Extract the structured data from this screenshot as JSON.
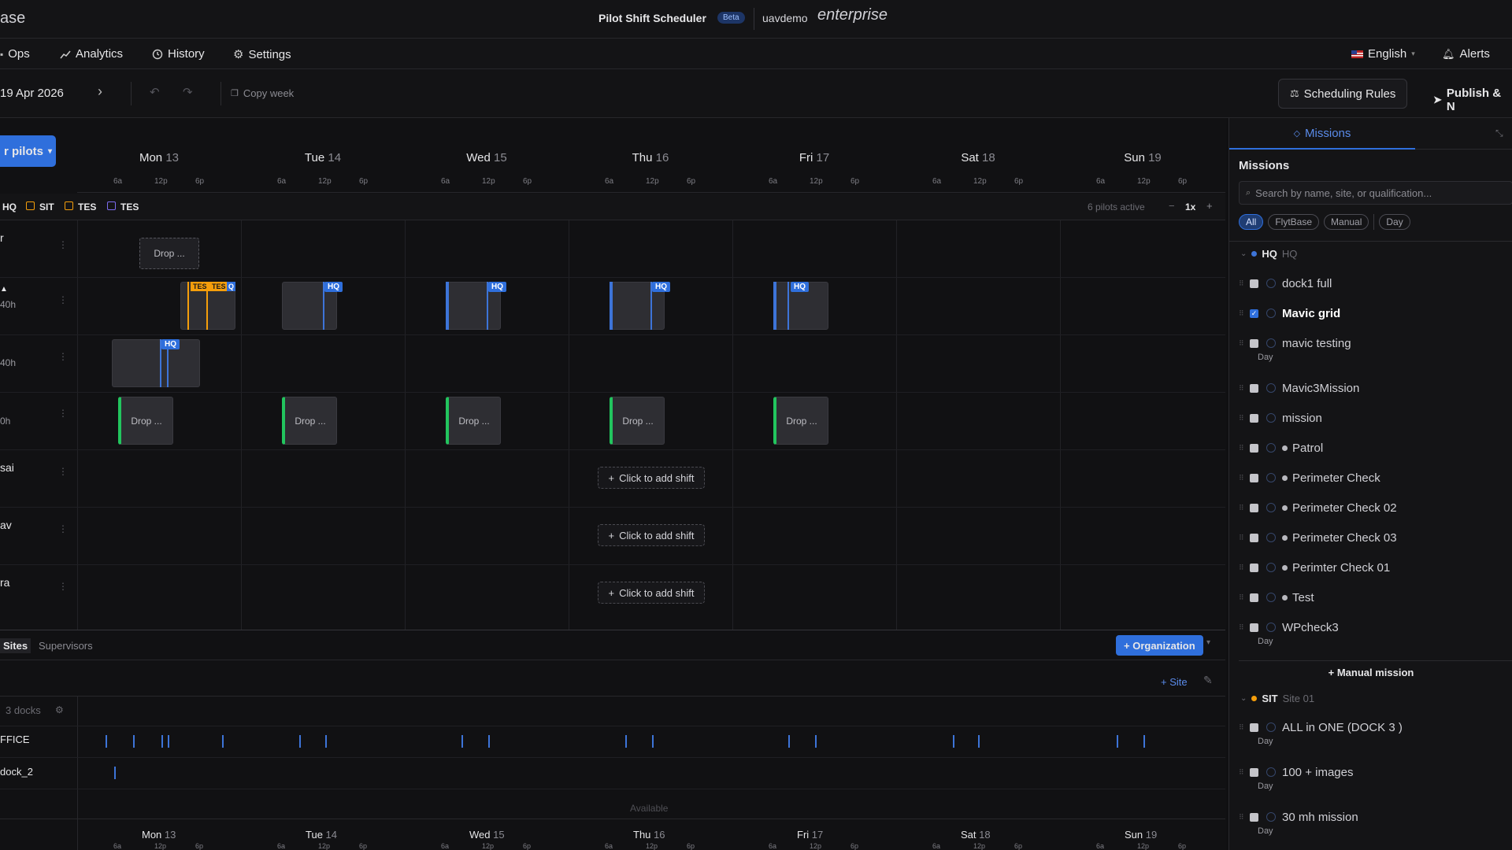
{
  "topbar": {
    "brand_fragment": "ase",
    "app_title": "Pilot Shift Scheduler",
    "beta_badge": "Beta",
    "org": "uavdemo",
    "logo_text": "enterprise"
  },
  "nav": {
    "tabs": [
      {
        "label": "Ops",
        "icon": "ops-icon"
      },
      {
        "label": "Analytics",
        "icon": "analytics-icon"
      },
      {
        "label": "History",
        "icon": "history-icon"
      },
      {
        "label": "Settings",
        "icon": "gear-icon"
      }
    ],
    "language": "English",
    "alerts": "Alerts"
  },
  "toolbar": {
    "date_range": "19 Apr 2026",
    "copy_week": "Copy week",
    "scheduling_rules": "Scheduling Rules",
    "publish": "Publish & N"
  },
  "schedule": {
    "filter_button": "r pilots",
    "days": [
      {
        "name": "Mon",
        "num": "13"
      },
      {
        "name": "Tue",
        "num": "14"
      },
      {
        "name": "Wed",
        "num": "15"
      },
      {
        "name": "Thu",
        "num": "16"
      },
      {
        "name": "Fri",
        "num": "17"
      },
      {
        "name": "Sat",
        "num": "18"
      },
      {
        "name": "Sun",
        "num": "19"
      }
    ],
    "ticks": [
      "6a",
      "12p",
      "6p"
    ],
    "site_filters": [
      "HQ",
      "SIT",
      "TES",
      "TES"
    ],
    "pilots_active": "6 pilots active",
    "zoom": "1x",
    "zoom_minus": "−",
    "zoom_plus": "+",
    "rows": [
      {
        "name": "r",
        "hours": ""
      },
      {
        "name": "",
        "hours": "40h"
      },
      {
        "name": "",
        "hours": "40h"
      },
      {
        "name": "",
        "hours": "0h"
      },
      {
        "name": "sai",
        "hours": ""
      },
      {
        "name": "av",
        "hours": ""
      },
      {
        "name": "ra",
        "hours": ""
      }
    ],
    "drop_label": "Drop ...",
    "hq_label": "HQ",
    "tes_label": "TES",
    "tes_label_2": "TES",
    "add_shift_label": "Click to add shift"
  },
  "bottom": {
    "tabs": [
      "Sites",
      "Supervisors"
    ],
    "organization_button": "+ Organization",
    "site_button": "+ Site",
    "docks_count": "3 docks",
    "dock_rows": [
      "FFICE",
      "dock_2"
    ],
    "available": "Available"
  },
  "right_panel": {
    "tab": "Missions",
    "heading": "Missions",
    "search_placeholder": "Search by name, site, or qualification...",
    "filters": [
      "All",
      "FlytBase",
      "Manual",
      "Day"
    ],
    "groups": [
      {
        "code": "HQ",
        "name": "HQ",
        "items": [
          {
            "label": "dock1 full",
            "checked": false,
            "tag": ""
          },
          {
            "label": "Mavic grid",
            "checked": true,
            "tag": ""
          },
          {
            "label": "mavic testing",
            "checked": false,
            "tag": "Day"
          },
          {
            "label": "Mavic3Mission",
            "checked": false,
            "tag": ""
          },
          {
            "label": "mission",
            "checked": false,
            "tag": ""
          },
          {
            "label": "Patrol",
            "checked": false,
            "tag": ""
          },
          {
            "label": "Perimeter Check",
            "checked": false,
            "tag": ""
          },
          {
            "label": "Perimeter Check 02",
            "checked": false,
            "tag": ""
          },
          {
            "label": "Perimeter Check 03",
            "checked": false,
            "tag": ""
          },
          {
            "label": "Perimter Check 01",
            "checked": false,
            "tag": ""
          },
          {
            "label": "Test",
            "checked": false,
            "tag": ""
          },
          {
            "label": "WPcheck3",
            "checked": false,
            "tag": "Day"
          }
        ]
      },
      {
        "code": "SIT",
        "name": "Site 01",
        "items": [
          {
            "label": "ALL in ONE (DOCK 3 )",
            "checked": false,
            "tag": "Day"
          },
          {
            "label": "100 + images",
            "checked": false,
            "tag": "Day"
          },
          {
            "label": "30 mh mission",
            "checked": false,
            "tag": "Day"
          }
        ]
      }
    ],
    "manual_mission": "+ Manual mission"
  },
  "colors": {
    "accent": "#2f6fdc",
    "green": "#22c55e",
    "orange": "#f59e0b",
    "purple": "#7c6cf0"
  }
}
